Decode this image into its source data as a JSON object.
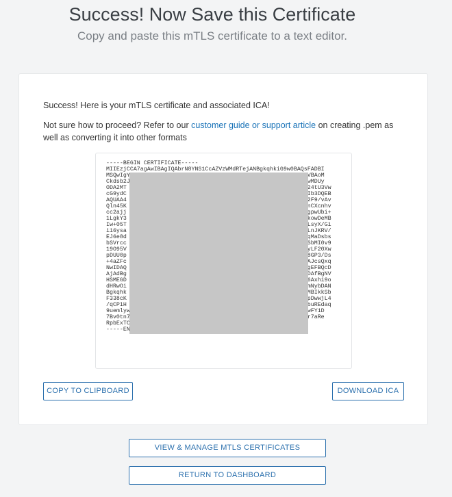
{
  "header": {
    "title": "Success! Now Save this Certificate",
    "subtitle": "Copy and paste this mTLS certificate to a text editor."
  },
  "card": {
    "intro": "Success! Here is your mTLS certificate and associated ICA!",
    "proceed_before": "Not sure how to proceed? Refer to our ",
    "proceed_link": "customer guide or support article",
    "proceed_after": " on creating .pem as well as converting it into other formats"
  },
  "certificate": {
    "lines": [
      "-----BEGIN CERTIFICATE-----",
      "MIIEzjCCA7agAwIBAgIQAbrN8YNS1CcAZVzWMdRTejANBgkqhkiG9w0BAQsFADBI",
      "MSQwIgYDVQQDDBtTdGFnaW5nIEF0bGFzIEFQSSBtVExTIFJvb3QxEzARBgNVBAoM",
      "Ckdsb2JhbFNpZ24xCzAJBgNVBAYTAkdCMB4XDTI2MDUyOTAzMjYxM1oXDTMwMDUy",
      "ODA2MT                                                   pZ24tU3Vw",
      "cG9ydC                                                   GSIb3DQEB",
      "AQUAA4                                                   SJ2F9/vAv",
      "Qln45K                                                   UunCXcnhv",
      "cc2ajj                                                   f5gpwUbi+",
      "1LgkY3                                                   qhkowDeMB",
      "Iw+05T                                                   orLsyX/Gi",
      "i16ysa                                                   1JLnJKRV/",
      "EJ6e8d                                                   +0qMaDsbs",
      "bSVrcc                                                   A0SbMI0v9",
      "19O95V                                                   4HyLF20Xw",
      "pDUU0p                                                   Uk8GP3/Ds",
      "+4aZFc                                                   L4AJcsQxq",
      "NwIDAQ                                                   rBgEFBQcD",
      "AjAdBg                                                   wADAfBgNV",
      "HSMEGD                                                   gM6Axhi9o",
      "dHRwOi                                                   nLmNybDAN",
      "Bgkqhk                                                   VwMBIkkSb",
      "F338cK                                                   XIpDwwjL4",
      "/qCP1H                                                   d3buREdaq",
      "9uemlywIYGCk1VZnX71RoEO3PJ1i4kX/UVpsfA6Z0smLvTv0tboaVzfE8mZwFY1D",
      "7Bv0tn7KCn+1I1V6h1AfhLUGDt2vXstIotd549yHDt8gxF9umiH4ux2ony8r7aRe",
      "RpbExTCOaLrWLL0E+emsoQ6KJowkrtWWjzI13HYIJ7mJiw==",
      "-----END CERTIFICATE-----"
    ]
  },
  "actions": {
    "copy_label": "COPY TO CLIPBOARD",
    "download_label": "DOWNLOAD ICA",
    "manage_label": "VIEW & MANAGE MTLS CERTIFICATES",
    "dashboard_label": "RETURN TO DASHBOARD"
  },
  "colors": {
    "accent": "#2a6fad",
    "link": "#1a73b8",
    "redaction": "#c6c6c6"
  }
}
